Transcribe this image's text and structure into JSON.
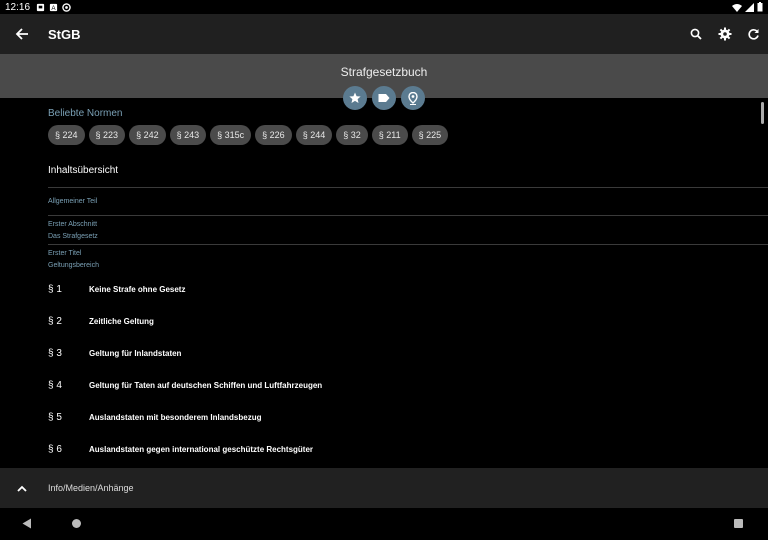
{
  "status_bar": {
    "time": "12:16"
  },
  "app_bar": {
    "title": "StGB",
    "back_icon": "arrow-left-icon",
    "actions": [
      "search-icon",
      "gear-icon",
      "refresh-icon"
    ]
  },
  "header": {
    "law_name": "Strafgesetzbuch",
    "fab_icons": [
      "star-icon",
      "tag-icon",
      "location-pin-icon"
    ],
    "fab_color": "#5b7b90"
  },
  "popular": {
    "title": "Beliebte Normen",
    "chips": [
      "§ 224",
      "§ 223",
      "§ 242",
      "§ 243",
      "§ 315c",
      "§ 226",
      "§ 244",
      "§ 32",
      "§ 211",
      "§ 225"
    ]
  },
  "toc": {
    "title": "Inhaltsübersicht",
    "part": "Allgemeiner Teil",
    "section_label": "Erster Abschnitt",
    "section_name": "Das Strafgesetz",
    "title_label": "Erster Titel",
    "title_name": "Geltungsbereich",
    "paragraphs": [
      {
        "num": "§ 1",
        "title": "Keine Strafe ohne Gesetz"
      },
      {
        "num": "§ 2",
        "title": "Zeitliche Geltung"
      },
      {
        "num": "§ 3",
        "title": "Geltung für Inlandstaten"
      },
      {
        "num": "§ 4",
        "title": "Geltung für Taten auf deutschen Schiffen und Luftfahrzeugen"
      },
      {
        "num": "§ 5",
        "title": "Auslandstaten mit besonderem Inlandsbezug"
      },
      {
        "num": "§ 6",
        "title": "Auslandstaten gegen international geschützte Rechtsgüter"
      }
    ]
  },
  "bottom_sheet": {
    "label": "Info/Medien/Anhänge",
    "icon": "chevron-up-icon"
  },
  "colors": {
    "accent": "#7aa0b5",
    "band": "#4a4a4a",
    "appbar": "#202020",
    "chip": "#4b4b4b"
  }
}
